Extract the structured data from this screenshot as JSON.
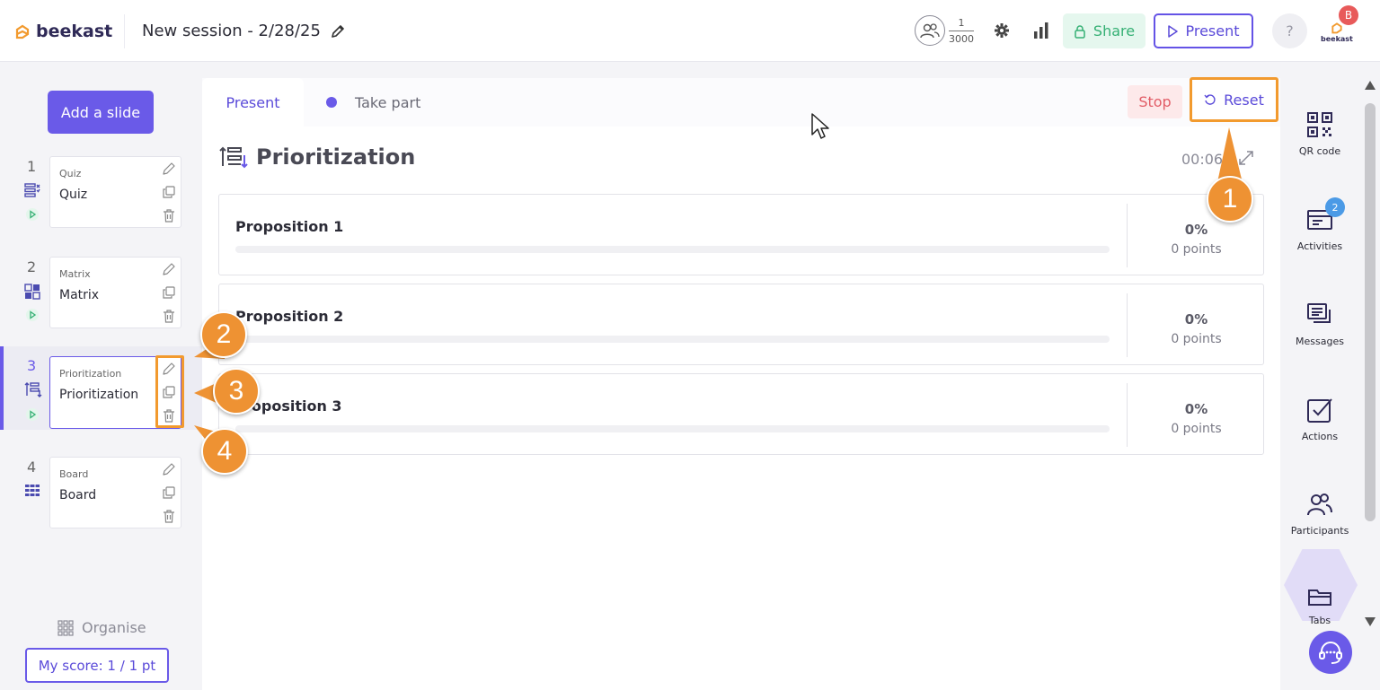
{
  "header": {
    "brand": "beekast",
    "session_title": "New session - 2/28/25",
    "participants_current": "1",
    "participants_max": "3000",
    "share_label": "Share",
    "present_label": "Present",
    "help_label": "?",
    "avatar_initial": "B",
    "avatar_brand": "beekast"
  },
  "sidebar": {
    "add_slide_label": "Add a slide",
    "slides": [
      {
        "number": "1",
        "type": "Quiz",
        "name": "Quiz",
        "icon": "quiz-icon"
      },
      {
        "number": "2",
        "type": "Matrix",
        "name": "Matrix",
        "icon": "matrix-icon"
      },
      {
        "number": "3",
        "type": "Prioritization",
        "name": "Prioritization",
        "icon": "prioritization-icon",
        "active": true
      },
      {
        "number": "4",
        "type": "Board",
        "name": "Board",
        "icon": "board-icon"
      }
    ],
    "organise_label": "Organise",
    "my_score_label": "My score: 1 / 1 pt"
  },
  "main": {
    "tab_present": "Present",
    "tab_take_part": "Take part",
    "stop_label": "Stop",
    "reset_label": "Reset",
    "activity_title": "Prioritization",
    "timer": "00:06",
    "propositions": [
      {
        "name": "Proposition 1",
        "percent": "0%",
        "points": "0 points"
      },
      {
        "name": "Proposition 2",
        "percent": "0%",
        "points": "0 points"
      },
      {
        "name": "roposition 3",
        "percent": "0%",
        "points": "0 points"
      }
    ]
  },
  "right_panel": {
    "items": [
      {
        "label": "QR code",
        "icon": "qr-code-icon"
      },
      {
        "label": "Activities",
        "icon": "activities-icon",
        "badge": "2"
      },
      {
        "label": "Messages",
        "icon": "messages-icon"
      },
      {
        "label": "Actions",
        "icon": "actions-icon"
      },
      {
        "label": "Participants",
        "icon": "participants-icon"
      },
      {
        "label": "Tabs",
        "icon": "tabs-icon"
      }
    ]
  },
  "callouts": [
    "1",
    "2",
    "3",
    "4"
  ],
  "colors": {
    "accent": "#6a5ae8",
    "highlight": "#f29a2e",
    "share": "#35b074",
    "stop": "#e25d67",
    "callout": "#ee9233"
  }
}
